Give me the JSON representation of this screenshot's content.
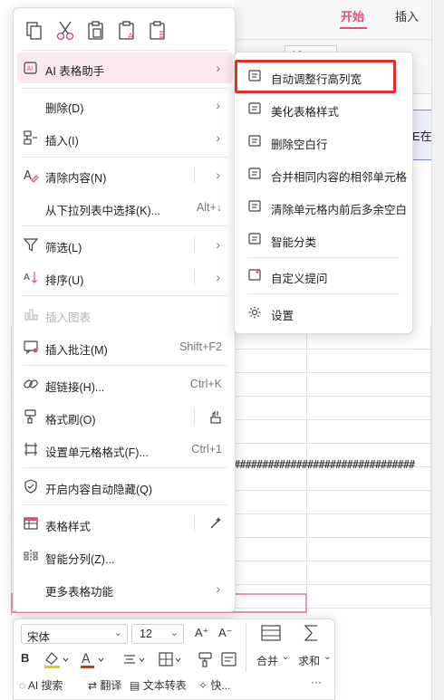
{
  "ribbon": {
    "tab_start": "开始",
    "tab_insert": "插入",
    "font_size": "12",
    "cell_fragment": "E在("
  },
  "sheet": {
    "hash_text": "################################"
  },
  "context_menu": {
    "quick_icons": [
      "copy-icon",
      "cut-icon",
      "paste-icon",
      "paste-text-icon",
      "paste-format-icon"
    ],
    "items": [
      {
        "label": "AI 表格助手",
        "shortcut": "",
        "arrow": "›",
        "icon": "ai-assistant-icon"
      },
      {
        "label": "删除(D)",
        "shortcut": "",
        "arrow": "›",
        "icon": ""
      },
      {
        "label": "插入(I)",
        "shortcut": "",
        "arrow": "›",
        "icon": "insert-icon"
      },
      {
        "label": "清除内容(N)",
        "shortcut": "",
        "arrow": "›",
        "icon": "clear-icon"
      },
      {
        "label": "从下拉列表中选择(K)...",
        "shortcut": "Alt+↓",
        "arrow": "",
        "icon": ""
      },
      {
        "label": "筛选(L)",
        "shortcut": "",
        "arrow": "›",
        "icon": "filter-icon"
      },
      {
        "label": "排序(U)",
        "shortcut": "",
        "arrow": "›",
        "icon": "sort-icon"
      },
      {
        "label": "插入图表",
        "shortcut": "",
        "arrow": "",
        "icon": "chart-icon"
      },
      {
        "label": "插入批注(M)",
        "shortcut": "Shift+F2",
        "arrow": "",
        "icon": "comment-icon"
      },
      {
        "label": "超链接(H)...",
        "shortcut": "Ctrl+K",
        "arrow": "",
        "icon": "link-icon"
      },
      {
        "label": "格式刷(O)",
        "shortcut": "",
        "arrow": "",
        "icon": "format-painter-icon"
      },
      {
        "label": "设置单元格格式(F)...",
        "shortcut": "Ctrl+1",
        "arrow": "",
        "icon": "cell-format-icon"
      },
      {
        "label": "开启内容自动隐藏(Q)",
        "shortcut": "",
        "arrow": "",
        "icon": "shield-icon"
      },
      {
        "label": "表格样式",
        "shortcut": "",
        "arrow": "",
        "icon": "table-style-icon"
      },
      {
        "label": "智能分列(Z)...",
        "shortcut": "",
        "arrow": "",
        "icon": "split-column-icon"
      },
      {
        "label": "更多表格功能",
        "shortcut": "",
        "arrow": "›",
        "icon": ""
      }
    ]
  },
  "sub_menu": {
    "items": [
      {
        "label": "自动调整行高列宽",
        "icon": "ai-doc-icon"
      },
      {
        "label": "美化表格样式",
        "icon": "ai-doc-icon"
      },
      {
        "label": "删除空白行",
        "icon": "ai-doc-icon"
      },
      {
        "label": "合并相同内容的相邻单元格",
        "icon": "ai-doc-icon"
      },
      {
        "label": "清除单元格内前后多余空白",
        "icon": "ai-doc-icon"
      },
      {
        "label": "智能分类",
        "icon": "ai-doc-icon"
      },
      {
        "label": "自定义提问",
        "icon": "custom-ask-icon"
      },
      {
        "label": "设置",
        "icon": "gear-icon"
      }
    ]
  },
  "mini_toolbar": {
    "font_name": "宋体",
    "font_size": "12",
    "grow_font": "A⁺",
    "shrink_font": "A⁻",
    "bold": "B",
    "merge_label": "合并",
    "sum_label": "求和",
    "ai_search": "AI 搜索",
    "translate": "翻译",
    "text_convert": "文本转表",
    "quick": "快...",
    "more": "···"
  },
  "colors": {
    "accent": "#e0517a",
    "hover_bg": "#fbe7ee",
    "highlight_red": "#e0302b"
  }
}
